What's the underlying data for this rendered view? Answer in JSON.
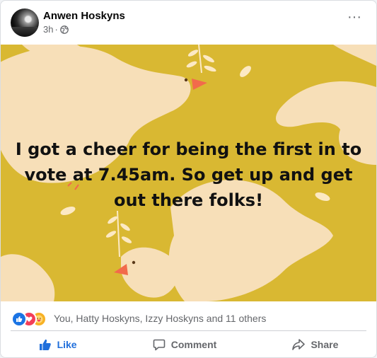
{
  "post": {
    "author": "Anwen Hoskyns",
    "time": "3h",
    "separator": "·",
    "privacy_icon": "globe-icon",
    "menu_icon": "more-horizontal-icon",
    "menu_label": "···",
    "image_text_lines": [
      "I got a cheer for being the first in to",
      "vote at 7.45am. So get up and get",
      "out there folks!"
    ],
    "image_colors": {
      "background": "#d9b832",
      "dove": "#f7dfb8",
      "beak": "#f26a4b",
      "leaf": "#fce9c4"
    }
  },
  "reactions": {
    "icons": [
      "like-reaction-icon",
      "love-reaction-icon",
      "care-reaction-icon"
    ],
    "summary": "You, Hatty Hoskyns, Izzy Hoskyns and 11 others"
  },
  "actions": {
    "like_label": "Like",
    "comment_label": "Comment",
    "share_label": "Share"
  },
  "colors": {
    "like_active": "#216fdb",
    "secondary_text": "#65676b"
  }
}
